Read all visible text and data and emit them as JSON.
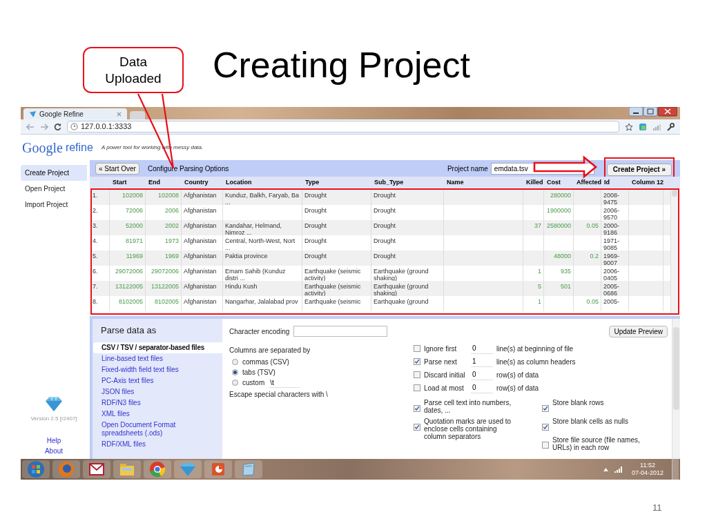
{
  "slide": {
    "title": "Creating Project",
    "callout": "Data Uploaded",
    "page_number": "11"
  },
  "browser": {
    "tab_title": "Google Refine",
    "url": "127.0.0.1:3333"
  },
  "app": {
    "logo": "Google",
    "product": "refine",
    "tagline": "A power tool for working with messy data.",
    "sidebar": [
      {
        "label": "Create Project",
        "selected": true
      },
      {
        "label": "Open Project",
        "selected": false
      },
      {
        "label": "Import Project",
        "selected": false
      }
    ],
    "version": "Version 2.5 [r2407]",
    "links": [
      "Help",
      "About"
    ]
  },
  "toolbar": {
    "start_over": "« Start Over",
    "heading": "Configure Parsing Options",
    "project_name_label": "Project name",
    "project_name": "emdata.tsv",
    "create_button": "Create Project »"
  },
  "table": {
    "columns": [
      {
        "label": "Start",
        "kind": "number"
      },
      {
        "label": "End",
        "kind": "number"
      },
      {
        "label": "Country",
        "kind": "text"
      },
      {
        "label": "Location",
        "kind": "text"
      },
      {
        "label": "Type",
        "kind": "text"
      },
      {
        "label": "Sub_Type",
        "kind": "text"
      },
      {
        "label": "Name",
        "kind": "text"
      },
      {
        "label": "Killed",
        "kind": "number"
      },
      {
        "label": "Cost",
        "kind": "number"
      },
      {
        "label": "Affected",
        "kind": "number"
      },
      {
        "label": "Id",
        "kind": "text"
      },
      {
        "label": "Column 12",
        "kind": "text"
      }
    ],
    "rows": [
      {
        "index": "1.",
        "cells": [
          "102008",
          "102008",
          "Afghanistan",
          "Kunduz, Balkh, Faryab, Ba ...",
          "Drought",
          "Drought",
          null,
          null,
          "280000",
          null,
          "2008-9475",
          null
        ]
      },
      {
        "index": "2.",
        "cells": [
          "72006",
          "2006",
          "Afghanistan",
          null,
          "Drought",
          "Drought",
          null,
          null,
          "1900000",
          null,
          "2006-9570",
          null
        ]
      },
      {
        "index": "3.",
        "cells": [
          "52000",
          "2002",
          "Afghanistan",
          "Kandahar, Helmand, Nimroz ...",
          "Drought",
          "Drought",
          null,
          "37",
          "2580000",
          "0.05",
          "2000-9186",
          null
        ]
      },
      {
        "index": "4.",
        "cells": [
          "81971",
          "1973",
          "Afghanistan",
          "Central, North-West, Nort ...",
          "Drought",
          "Drought",
          null,
          null,
          null,
          null,
          "1971-9085",
          null
        ]
      },
      {
        "index": "5.",
        "cells": [
          "11969",
          "1969",
          "Afghanistan",
          "Paktia province",
          "Drought",
          "Drought",
          null,
          null,
          "48000",
          "0.2",
          "1969-9007",
          null
        ]
      },
      {
        "index": "6.",
        "cells": [
          "29072006",
          "29072006",
          "Afghanistan",
          "Emam Sahib (Kunduz distri ...",
          "Earthquake (seismic activity)",
          "Earthquake (ground shaking)",
          null,
          "1",
          "935",
          null,
          "2006-0405",
          null
        ]
      },
      {
        "index": "7.",
        "cells": [
          "13122005",
          "13122005",
          "Afghanistan",
          "Hindu Kush",
          "Earthquake (seismic activity)",
          "Earthquake (ground shaking)",
          null,
          "5",
          "501",
          null,
          "2005-0686",
          null
        ]
      },
      {
        "index": "8.",
        "cells": [
          "8102005",
          "8102005",
          "Afghanistan",
          "Nangarhar, Jalalabad prov",
          "Earthquake (seismic",
          "Earthquake (ground",
          null,
          "1",
          null,
          "0.05",
          "2005-",
          null
        ]
      }
    ]
  },
  "parse": {
    "heading": "Parse data as",
    "formats": [
      {
        "label": "CSV / TSV / separator-based files",
        "selected": true
      },
      {
        "label": "Line-based text files",
        "selected": false
      },
      {
        "label": "Fixed-width field text files",
        "selected": false
      },
      {
        "label": "PC-Axis text files",
        "selected": false
      },
      {
        "label": "JSON files",
        "selected": false
      },
      {
        "label": "RDF/N3 files",
        "selected": false
      },
      {
        "label": "XML files",
        "selected": false
      },
      {
        "label": "Open Document Format spreadsheets (.ods)",
        "selected": false
      },
      {
        "label": "RDF/XML files",
        "selected": false
      }
    ],
    "encoding_label": "Character encoding",
    "separator_label": "Columns are separated by",
    "separators": [
      {
        "label": "commas (CSV)",
        "selected": false
      },
      {
        "label": "tabs (TSV)",
        "selected": true
      },
      {
        "label": "custom",
        "selected": false,
        "value": "\\t"
      }
    ],
    "escape_label": "Escape special characters with \\",
    "update_button": "Update Preview",
    "line_options": [
      {
        "label": "Ignore first",
        "checked": false,
        "value": "0",
        "suffix": "line(s) at beginning of file"
      },
      {
        "label": "Parse next",
        "checked": true,
        "value": "1",
        "suffix": "line(s) as column headers"
      },
      {
        "label": "Discard initial",
        "checked": false,
        "value": "0",
        "suffix": "row(s) of data"
      },
      {
        "label": "Load at most",
        "checked": false,
        "value": "0",
        "suffix": "row(s) of data"
      }
    ],
    "left_options": [
      {
        "label": "Parse cell text into numbers, dates, ...",
        "checked": true
      },
      {
        "label": "Quotation marks are used to enclose cells containing column separators",
        "checked": true
      }
    ],
    "right_options": [
      {
        "label": "Store blank rows",
        "checked": true
      },
      {
        "label": "Store blank cells as nulls",
        "checked": true
      },
      {
        "label": "Store file source (file names, URLs) in each row",
        "checked": false
      }
    ]
  },
  "taskbar": {
    "time": "11:52",
    "date": "07-04-2012"
  }
}
